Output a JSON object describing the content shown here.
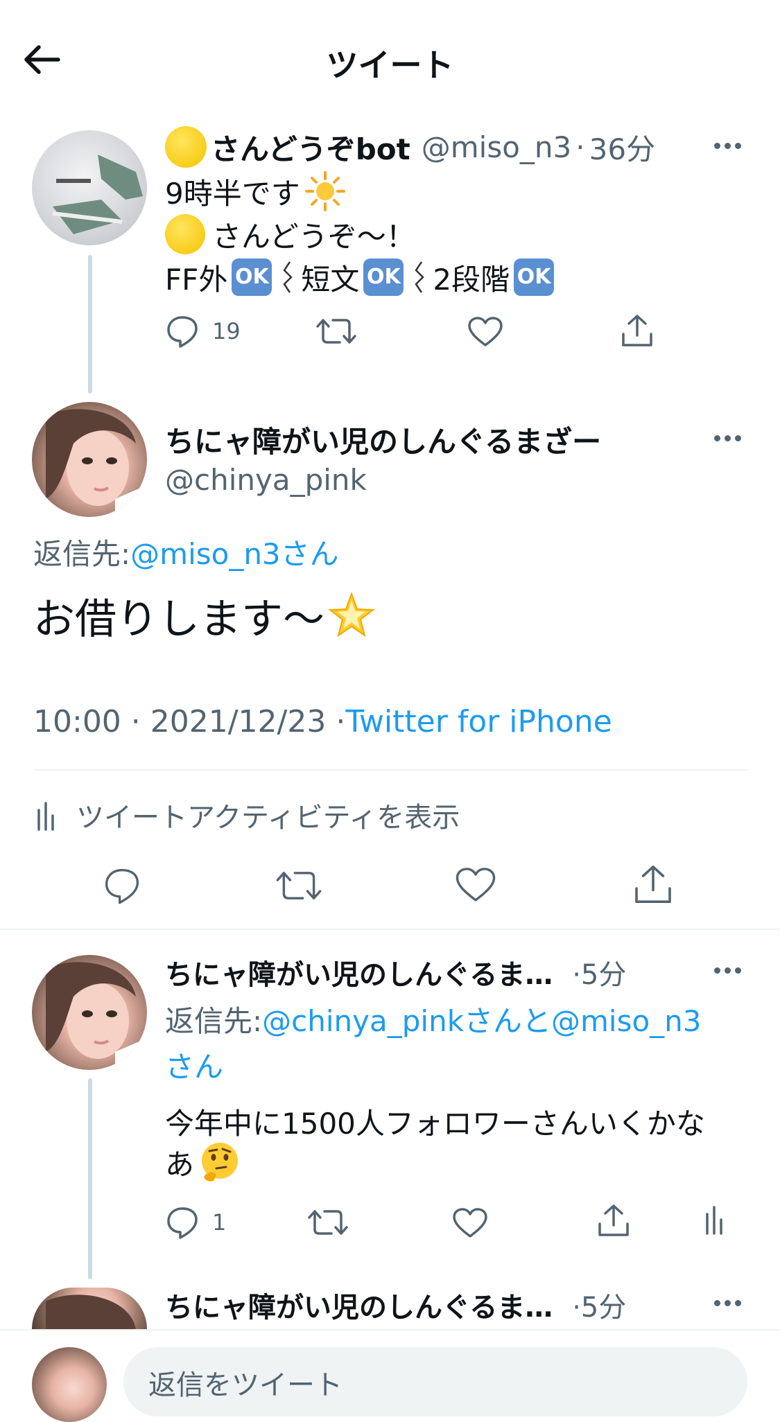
{
  "header": {
    "title": "ツイート"
  },
  "tweet1": {
    "display_name": "さんどうぞbot",
    "handle": "@miso_n3",
    "sep": "·",
    "time": "36分",
    "line1": "9時半です",
    "line2": "さんどうぞ〜！",
    "line3_a": "FF外",
    "line3_b": "短文",
    "line3_c": "2段階",
    "ok": "OK",
    "reply_count": "19"
  },
  "main_tweet": {
    "display_name": "ちにャ障がい児のしんぐるまざー",
    "handle": "@chinya_pink",
    "reply_prefix": "返信先: ",
    "reply_to": "@miso_n3さん",
    "body": "お借りします〜",
    "timestamp": "10:00 · 2021/12/23 · ",
    "source": "Twitter for iPhone",
    "activity": "ツイートアクティビティを表示"
  },
  "tweet3": {
    "display_name": "ちにャ障がい児のしんぐるま…",
    "time": "·5分",
    "reply_prefix": "返信先: ",
    "reply_to_line1": "@chinya_pinkさんと@miso_n3",
    "reply_to_line2": "さん",
    "body_line1": "今年中に1500人フォロワーさんいくかな",
    "body_line2": "あ",
    "reply_count": "1"
  },
  "tweet4": {
    "display_name": "ちにャ障がい児のしんぐるま…",
    "time": "·5分"
  },
  "composer": {
    "placeholder": "返信をツイート"
  },
  "colors": {
    "accent": "#1d9bf0",
    "muted": "#536471",
    "divider": "#eff3f4"
  }
}
